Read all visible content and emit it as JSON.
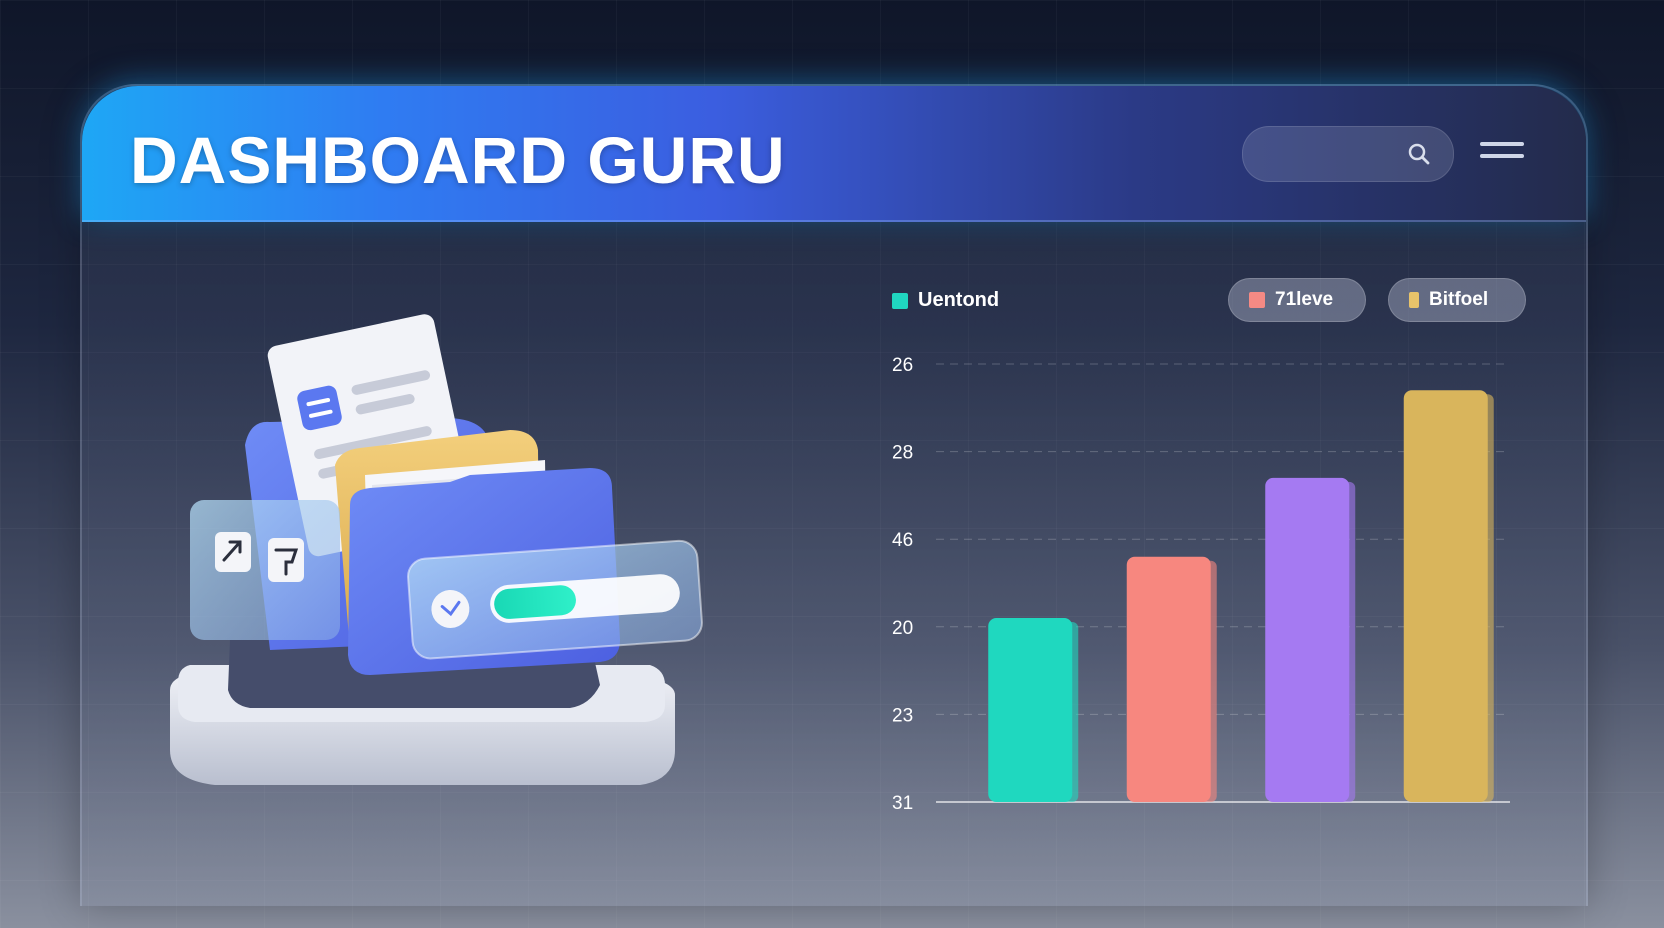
{
  "header": {
    "title": "DASHBOARD GURU",
    "search_placeholder": ""
  },
  "icons": {
    "search": "search-icon",
    "menu": "hamburger-menu-icon"
  },
  "legend": [
    {
      "label": "Uentond",
      "color": "#20d6c0",
      "style": "plain"
    },
    {
      "label": "71leve",
      "color": "#f58a84",
      "style": "pill"
    },
    {
      "label": "Bitfoel",
      "color": "#e8c36a",
      "style": "pill"
    }
  ],
  "chart_data": {
    "type": "bar",
    "y_tick_labels": [
      "26",
      "28",
      "46",
      "20",
      "23",
      "31"
    ],
    "categories": [
      "",
      "",
      "",
      ""
    ],
    "values": [
      2.1,
      2.8,
      3.7,
      4.7
    ],
    "colors": [
      "#1fd8bf",
      "#f7877f",
      "#a57af2",
      "#d9b55c"
    ],
    "grid": true,
    "ylim": [
      0,
      5
    ]
  },
  "illustration": {
    "progress": 0.45,
    "icons": [
      "document-icon",
      "folder-icon",
      "arrow-icon",
      "pin-icon",
      "check-icon"
    ]
  },
  "colors": {
    "accent": "#1ea7f5",
    "header_dark": "#232b4b"
  }
}
